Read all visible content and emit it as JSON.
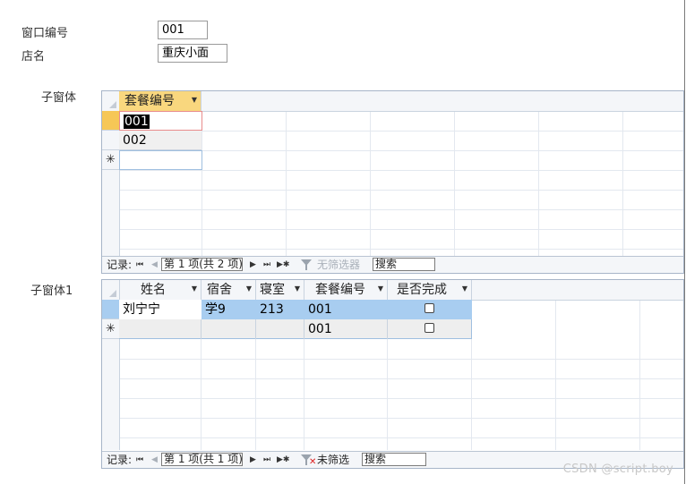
{
  "form": {
    "window_label": "窗口编号",
    "window_value": "001",
    "store_label": "店名",
    "store_value": "重庆小面"
  },
  "subform1": {
    "label": "子窗体",
    "columns": [
      {
        "label": "套餐编号"
      }
    ],
    "rows": [
      {
        "code": "001"
      },
      {
        "code": "002"
      }
    ],
    "new_row_marker": "✳",
    "nav": {
      "record_label": "记录:",
      "first_icon": "first-record-icon",
      "position": "第 1 项(共 2 项)",
      "filter_label": "无筛选器",
      "search_placeholder": "搜索"
    }
  },
  "subform2": {
    "label": "子窗体1",
    "columns": [
      {
        "label": "姓名"
      },
      {
        "label": "宿舍"
      },
      {
        "label": "寝室"
      },
      {
        "label": "套餐编号"
      },
      {
        "label": "是否完成"
      }
    ],
    "rows": [
      {
        "name": "刘宁宁",
        "dorm": "学9",
        "room": "213",
        "code": "001",
        "done": false
      }
    ],
    "new_row": {
      "code": "001"
    },
    "new_row_marker": "✳",
    "nav": {
      "record_label": "记录:",
      "position": "第 1 项(共 1 项)",
      "filter_label": "未筛选",
      "search_placeholder": "搜索"
    }
  },
  "watermark": "CSDN @script.boy",
  "colors": {
    "selected_row": "#a8cdf0",
    "active_header": "#f9d77e",
    "active_selector": "#f6c756",
    "focus_border": "#e88b8b",
    "text_highlight": "#000000"
  }
}
